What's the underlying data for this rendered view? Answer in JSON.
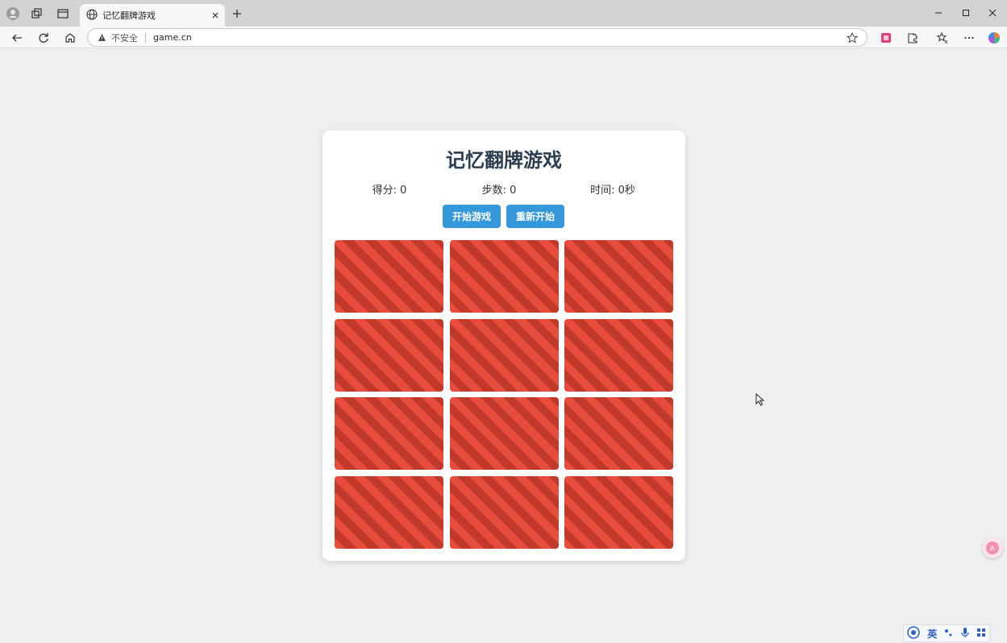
{
  "browser": {
    "tab_title": "记忆翻牌游戏",
    "security_label": "不安全",
    "url": "game.cn"
  },
  "game": {
    "title": "记忆翻牌游戏",
    "score_label": "得分: 0",
    "moves_label": "步数: 0",
    "time_label": "时间: 0秒",
    "start_button": "开始游戏",
    "restart_button": "重新开始",
    "cards": [
      {
        "state": "face-down"
      },
      {
        "state": "face-down"
      },
      {
        "state": "face-down"
      },
      {
        "state": "face-down"
      },
      {
        "state": "face-down"
      },
      {
        "state": "face-down"
      },
      {
        "state": "face-down"
      },
      {
        "state": "face-down"
      },
      {
        "state": "face-down"
      },
      {
        "state": "face-down"
      },
      {
        "state": "face-down"
      },
      {
        "state": "face-down"
      }
    ],
    "card_colors": {
      "primary": "#e74c3c",
      "stripe": "#c0392b"
    },
    "accent_color": "#3498db"
  },
  "ime": {
    "language": "英"
  }
}
